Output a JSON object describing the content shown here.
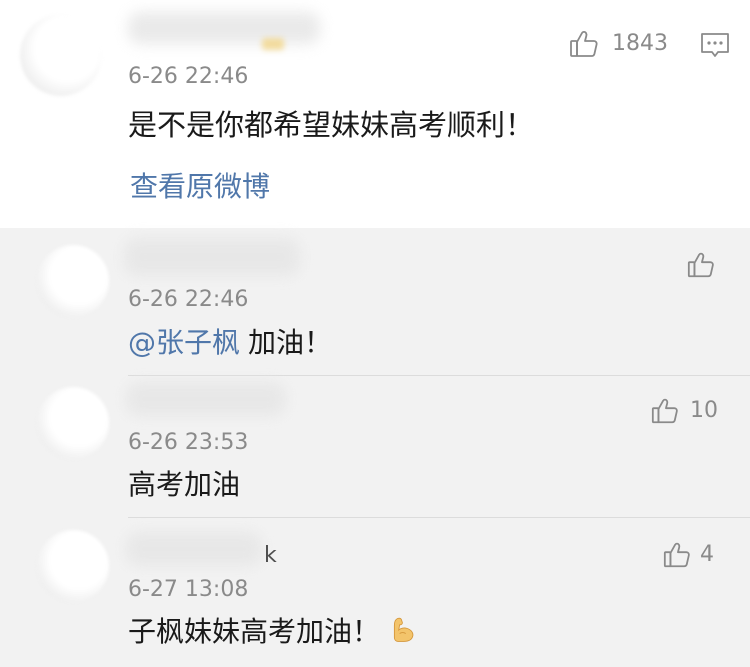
{
  "main_comment": {
    "like_count": "1843",
    "timestamp": "6-26 22:46",
    "text": "是不是你都希望妹妹高考顺利！",
    "view_original_label": "查看原微博"
  },
  "replies": [
    {
      "timestamp": "6-26 22:46",
      "mention": "@张子枫",
      "text": "加油！"
    },
    {
      "timestamp": "6-26 23:53",
      "text": "高考加油",
      "like_count": "10"
    },
    {
      "username_visible": "k",
      "timestamp": "6-27 13:08",
      "text": "子枫妹妹高考加油！",
      "like_count": "4"
    }
  ],
  "icons": {
    "like": "thumbs-up-icon",
    "reply": "comment-icon",
    "emoji": "flexed-biceps-icon"
  },
  "colors": {
    "text": "#1a1a1a",
    "meta": "#8a8a8a",
    "link": "#5077aa",
    "main_bg": "#ffffff",
    "reply_bg": "#f2f2f2",
    "divider": "#dcdcdc",
    "emoji_skin": "#f3c46b"
  }
}
